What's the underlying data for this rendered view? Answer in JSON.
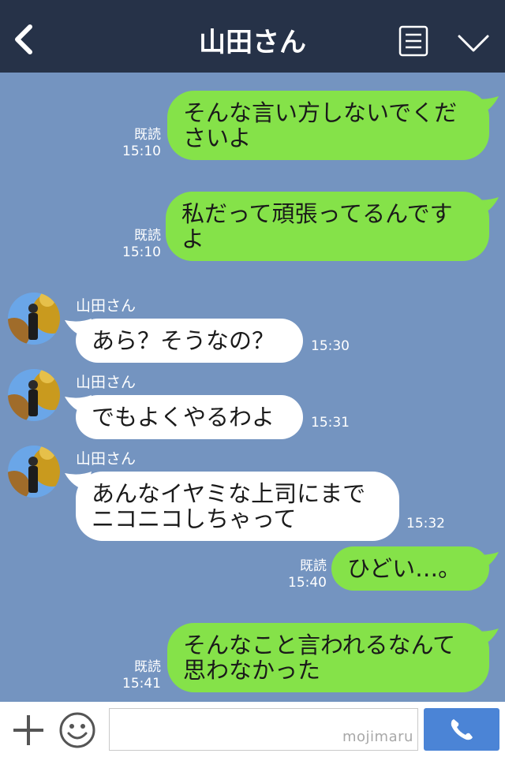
{
  "header": {
    "title": "山田さん",
    "bg_color": "#263248",
    "back_icon": "chevron-left-icon",
    "menu_icon": "list-icon",
    "down_icon": "chevron-down-icon"
  },
  "colors": {
    "chat_bg": "#7494c0",
    "outgoing_bubble": "#85e249",
    "incoming_bubble": "#ffffff",
    "send_button": "#4b84d6"
  },
  "messages": [
    {
      "from": "me",
      "text1": "そんな言い方しないでくだ",
      "text2": "さいよ",
      "read": "既読",
      "time": "15:10"
    },
    {
      "from": "me",
      "text1": "私だって頑張ってるんです",
      "text2": "よ",
      "read": "既読",
      "time": "15:10"
    },
    {
      "from": "other",
      "sender": "山田さん",
      "text1": "あら？そうなの？",
      "time": "15:30"
    },
    {
      "from": "other",
      "sender": "山田さん",
      "text1": "でもよくやるわよ",
      "time": "15:31"
    },
    {
      "from": "other",
      "sender": "山田さん",
      "text1": "あんなイヤミな上司にまで",
      "text2": "ニコニコしちゃって",
      "time": "15:32"
    },
    {
      "from": "me",
      "text1": "ひどい…。",
      "read": "既読",
      "time": "15:40"
    },
    {
      "from": "me",
      "text1": "そんなこと言われるなんて",
      "text2": "思わなかった",
      "read": "既読",
      "time": "15:41"
    }
  ],
  "footer": {
    "plus_icon": "plus-icon",
    "emoji_icon": "smiley-icon",
    "input_value": "",
    "watermark": "mojimaru",
    "call_icon": "phone-icon"
  }
}
